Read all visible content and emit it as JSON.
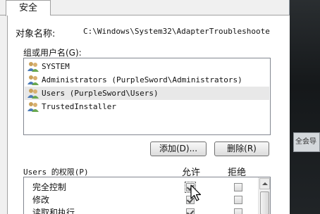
{
  "window": {
    "tab": "安全",
    "object_name_label": "对象名称:",
    "object_name_value": "C:\\Windows\\System32\\AdapterTroubleshoote",
    "groups_label": "组或用户名(G):"
  },
  "users": [
    {
      "icon": "user-group-icon",
      "label": "SYSTEM"
    },
    {
      "icon": "user-group-icon",
      "label": "Administrators (PurpleSword\\Administrators)"
    },
    {
      "icon": "user-group-icon",
      "label": "Users (PurpleSword\\Users)",
      "selected": true
    },
    {
      "icon": "user-group-icon",
      "label": "TrustedInstaller"
    }
  ],
  "buttons": {
    "add": "添加(D)...",
    "remove": "删除(R)"
  },
  "permissions": {
    "title": "Users 的权限(P)",
    "allow_header": "允许",
    "deny_header": "拒绝",
    "rows": [
      {
        "name": "完全控制",
        "allow": true,
        "deny": false
      },
      {
        "name": "修改",
        "allow": true,
        "deny": false
      },
      {
        "name": "读取和执行",
        "allow": true,
        "deny": false
      }
    ]
  },
  "background_fragment": "全会导"
}
